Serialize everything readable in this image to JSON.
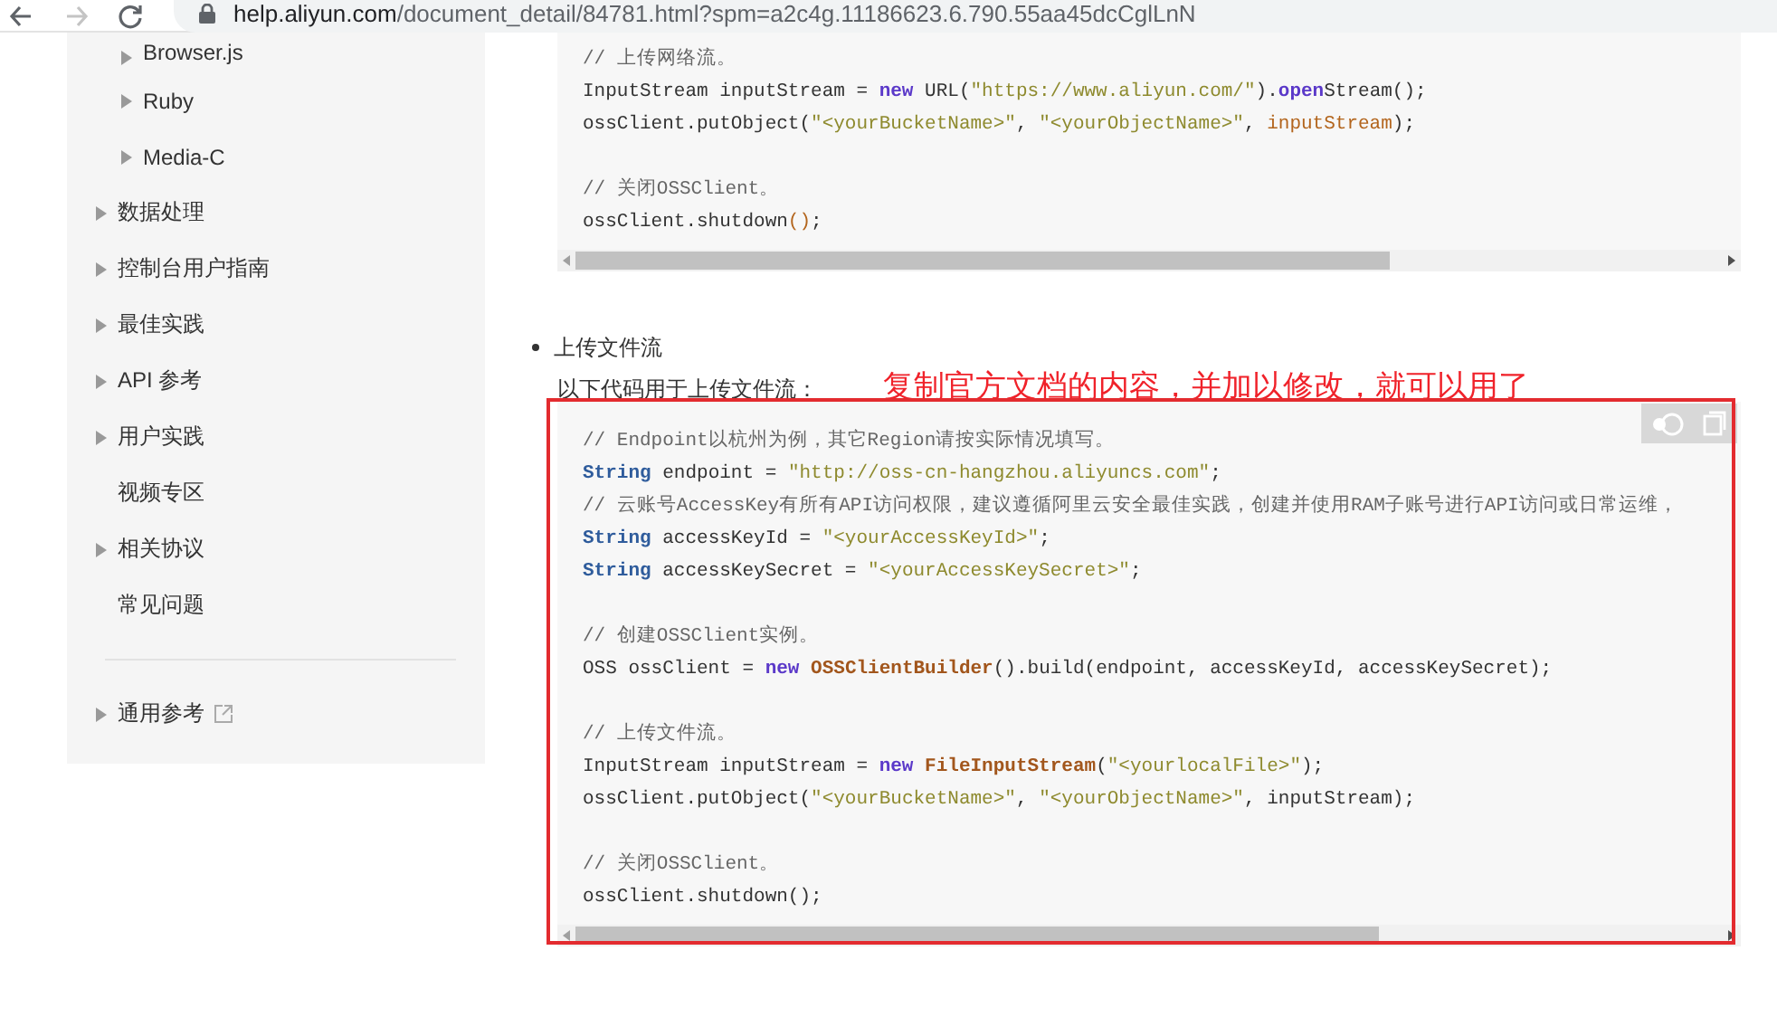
{
  "browser": {
    "back_enabled": true,
    "forward_enabled": false,
    "url": {
      "host": "help.aliyun.com",
      "path": "/document_detail/84781.html?spm=a2c4g.11186623.6.790.55aa45dcCglLnN"
    }
  },
  "sidebar": {
    "nested_items": [
      {
        "label": "Browser.js",
        "expandable": true
      },
      {
        "label": "Ruby",
        "expandable": true
      },
      {
        "label": "Media-C",
        "expandable": true
      }
    ],
    "items": [
      {
        "label": "数据处理",
        "expandable": true
      },
      {
        "label": "控制台用户指南",
        "expandable": true
      },
      {
        "label": "最佳实践",
        "expandable": true
      },
      {
        "label": "API 参考",
        "expandable": true
      },
      {
        "label": "用户实践",
        "expandable": true
      },
      {
        "label": "视频专区",
        "expandable": false
      },
      {
        "label": "相关协议",
        "expandable": true
      },
      {
        "label": "常见问题",
        "expandable": false
      }
    ],
    "footer_items": [
      {
        "label": "通用参考",
        "expandable": true,
        "external": true
      }
    ]
  },
  "code_block_1": {
    "lines": [
      {
        "kind": "code",
        "tokens": [
          {
            "kind": "comment",
            "text": "// 上传网络流。"
          }
        ]
      },
      {
        "kind": "code",
        "tokens": [
          {
            "kind": "plain",
            "text": "InputStream inputStream = "
          },
          {
            "kind": "keyword",
            "text": "new"
          },
          {
            "kind": "plain",
            "text": " URL("
          },
          {
            "kind": "string",
            "text": "\"https://www.aliyun.com/\""
          },
          {
            "kind": "plain",
            "text": ")."
          },
          {
            "kind": "keyword",
            "text": "open"
          },
          {
            "kind": "plain",
            "text": "Stream();"
          }
        ]
      },
      {
        "kind": "code",
        "tokens": [
          {
            "kind": "plain",
            "text": "ossClient.putObject("
          },
          {
            "kind": "string",
            "text": "\"<yourBucketName>\""
          },
          {
            "kind": "plain",
            "text": ", "
          },
          {
            "kind": "string",
            "text": "\"<yourObjectName>\""
          },
          {
            "kind": "plain",
            "text": ", "
          },
          {
            "kind": "variable",
            "text": "inputStream"
          },
          {
            "kind": "plain",
            "text": ");"
          }
        ]
      },
      {
        "kind": "blank"
      },
      {
        "kind": "code",
        "tokens": [
          {
            "kind": "comment",
            "text": "// 关闭OSSClient。"
          }
        ]
      },
      {
        "kind": "code",
        "tokens": [
          {
            "kind": "plain",
            "text": "ossClient.shutdown"
          },
          {
            "kind": "variable",
            "text": "()"
          },
          {
            "kind": "plain",
            "text": ";"
          }
        ]
      }
    ]
  },
  "section": {
    "bullet": "上传文件流",
    "intro": "以下代码用于上传文件流：",
    "annotation": "复制官方文档的内容，并加以修改，就可以用了"
  },
  "code_block_2": {
    "lines": [
      {
        "kind": "code",
        "tokens": [
          {
            "kind": "comment",
            "text": "// Endpoint以杭州为例，其它Region请按实际情况填写。"
          }
        ]
      },
      {
        "kind": "code",
        "tokens": [
          {
            "kind": "type",
            "text": "String"
          },
          {
            "kind": "plain",
            "text": " endpoint = "
          },
          {
            "kind": "string",
            "text": "\"http://oss-cn-hangzhou.aliyuncs.com\""
          },
          {
            "kind": "plain",
            "text": ";"
          }
        ]
      },
      {
        "kind": "code",
        "tokens": [
          {
            "kind": "comment",
            "text": "// 云账号AccessKey有所有API访问权限，建议遵循阿里云安全最佳实践，创建并使用RAM子账号进行API访问或日常运维，"
          }
        ]
      },
      {
        "kind": "code",
        "tokens": [
          {
            "kind": "type",
            "text": "String"
          },
          {
            "kind": "plain",
            "text": " accessKeyId = "
          },
          {
            "kind": "string",
            "text": "\"<yourAccessKeyId>\""
          },
          {
            "kind": "plain",
            "text": ";"
          }
        ]
      },
      {
        "kind": "code",
        "tokens": [
          {
            "kind": "type",
            "text": "String"
          },
          {
            "kind": "plain",
            "text": " accessKeySecret = "
          },
          {
            "kind": "string",
            "text": "\"<yourAccessKeySecret>\""
          },
          {
            "kind": "plain",
            "text": ";"
          }
        ]
      },
      {
        "kind": "blank"
      },
      {
        "kind": "code",
        "tokens": [
          {
            "kind": "comment",
            "text": "// 创建OSSClient实例。"
          }
        ]
      },
      {
        "kind": "code",
        "tokens": [
          {
            "kind": "plain",
            "text": "OSS ossClient = "
          },
          {
            "kind": "keyword",
            "text": "new"
          },
          {
            "kind": "class",
            "text": " OSSClientBuilder"
          },
          {
            "kind": "plain",
            "text": "().build(endpoint, accessKeyId, accessKeySecret);"
          }
        ]
      },
      {
        "kind": "blank"
      },
      {
        "kind": "code",
        "tokens": [
          {
            "kind": "comment",
            "text": "// 上传文件流。"
          }
        ]
      },
      {
        "kind": "code",
        "tokens": [
          {
            "kind": "plain",
            "text": "InputStream inputStream = "
          },
          {
            "kind": "keyword",
            "text": "new"
          },
          {
            "kind": "class",
            "text": " FileInputStream"
          },
          {
            "kind": "plain",
            "text": "("
          },
          {
            "kind": "string",
            "text": "\"<yourlocalFile>\""
          },
          {
            "kind": "plain",
            "text": ");"
          }
        ]
      },
      {
        "kind": "code",
        "tokens": [
          {
            "kind": "plain",
            "text": "ossClient.putObject("
          },
          {
            "kind": "string",
            "text": "\"<yourBucketName>\""
          },
          {
            "kind": "plain",
            "text": ", "
          },
          {
            "kind": "string",
            "text": "\"<yourObjectName>\""
          },
          {
            "kind": "plain",
            "text": ", inputStream);"
          }
        ]
      },
      {
        "kind": "blank"
      },
      {
        "kind": "code",
        "tokens": [
          {
            "kind": "comment",
            "text": "// 关闭OSSClient。"
          }
        ]
      },
      {
        "kind": "code",
        "tokens": [
          {
            "kind": "plain",
            "text": "ossClient.shutdown();"
          }
        ]
      }
    ]
  }
}
